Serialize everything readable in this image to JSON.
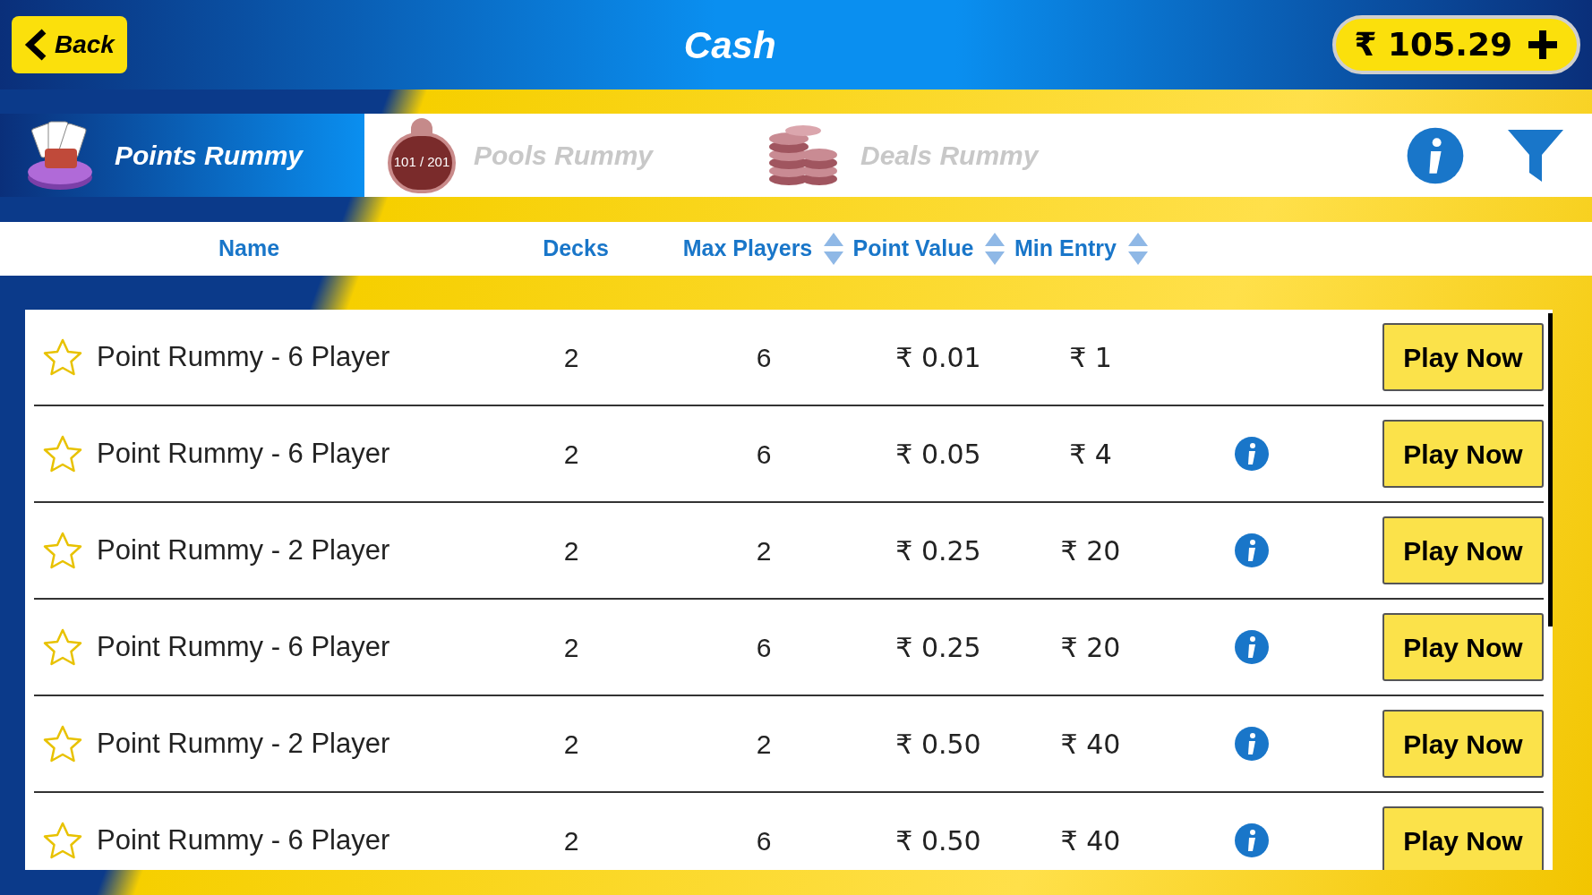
{
  "header": {
    "back": "Back",
    "title": "Cash",
    "balance": "₹ 105.29"
  },
  "tabs": [
    {
      "kind": "cards",
      "label": "Points Rummy",
      "selected": true
    },
    {
      "kind": "chip",
      "label": "Pools Rummy",
      "chip_label": "101 / 201",
      "selected": false
    },
    {
      "kind": "coins",
      "label": "Deals Rummy",
      "selected": false
    }
  ],
  "columns": [
    {
      "label": "Name",
      "sortable": false
    },
    {
      "label": "Decks",
      "sortable": false
    },
    {
      "label": "Max Players",
      "sortable": true
    },
    {
      "label": "Point Value",
      "sortable": true
    },
    {
      "label": "Min Entry",
      "sortable": true
    }
  ],
  "rows": [
    {
      "name": "Point Rummy - 6 Player",
      "decks": "2",
      "max_players": "6",
      "point_value": "₹ 0.01",
      "min_entry": "₹ 1",
      "info": false,
      "favorite": false,
      "action": "Play Now"
    },
    {
      "name": "Point Rummy - 6 Player",
      "decks": "2",
      "max_players": "6",
      "point_value": "₹ 0.05",
      "min_entry": "₹ 4",
      "info": true,
      "favorite": false,
      "action": "Play Now"
    },
    {
      "name": "Point Rummy - 2 Player",
      "decks": "2",
      "max_players": "2",
      "point_value": "₹ 0.25",
      "min_entry": "₹ 20",
      "info": true,
      "favorite": false,
      "action": "Play Now"
    },
    {
      "name": "Point Rummy - 6 Player",
      "decks": "2",
      "max_players": "6",
      "point_value": "₹ 0.25",
      "min_entry": "₹ 20",
      "info": true,
      "favorite": false,
      "action": "Play Now"
    },
    {
      "name": "Point Rummy - 2 Player",
      "decks": "2",
      "max_players": "2",
      "point_value": "₹ 0.50",
      "min_entry": "₹ 40",
      "info": true,
      "favorite": false,
      "action": "Play Now"
    },
    {
      "name": "Point Rummy - 6 Player",
      "decks": "2",
      "max_players": "6",
      "point_value": "₹ 0.50",
      "min_entry": "₹ 40",
      "info": true,
      "favorite": false,
      "action": "Play Now"
    }
  ]
}
